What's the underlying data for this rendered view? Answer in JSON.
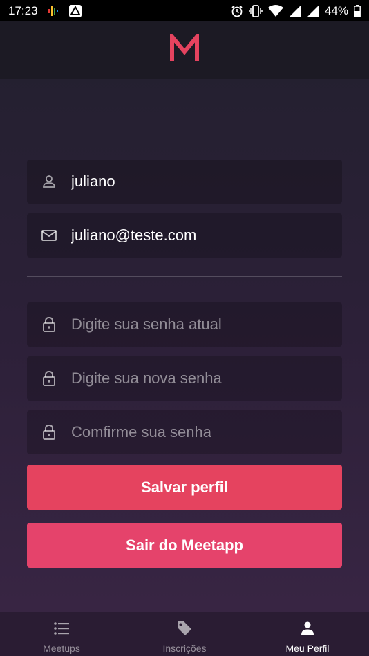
{
  "status_bar": {
    "time": "17:23",
    "battery": "44%"
  },
  "header": {
    "logo_text": "M",
    "brand_color": "#e5435f"
  },
  "profile_form": {
    "name": {
      "value": "juliano",
      "icon": "user-icon"
    },
    "email": {
      "value": "juliano@teste.com",
      "icon": "mail-icon"
    },
    "old_password": {
      "placeholder": "Digite sua senha atual",
      "icon": "lock-icon"
    },
    "new_password": {
      "placeholder": "Digite sua nova senha",
      "icon": "lock-icon"
    },
    "confirm_password": {
      "placeholder": "Comfirme sua senha",
      "icon": "lock-icon"
    }
  },
  "buttons": {
    "save_label": "Salvar perfil",
    "logout_label": "Sair do Meetapp"
  },
  "tabs": [
    {
      "label": "Meetups",
      "icon": "list-icon",
      "active": false
    },
    {
      "label": "Inscrições",
      "icon": "tag-icon",
      "active": false
    },
    {
      "label": "Meu Perfil",
      "icon": "person-icon",
      "active": true
    }
  ]
}
